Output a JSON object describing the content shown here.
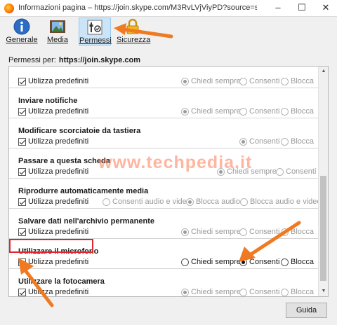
{
  "window": {
    "title": "Informazioni pagina – https://join.skype.com/M3RvLVjViyPD?source=scom&co...",
    "minimize": "–",
    "maximize": "☐",
    "close": "✕"
  },
  "toolbar": {
    "tabs": [
      {
        "label": "Generale",
        "icon": "info-icon",
        "active": false
      },
      {
        "label": "Media",
        "icon": "media-icon",
        "active": false
      },
      {
        "label": "Permessi",
        "icon": "permissions-icon",
        "active": true
      },
      {
        "label": "Sicurezza",
        "icon": "lock-icon",
        "active": false
      }
    ]
  },
  "permissions_for": {
    "label": "Permessi per:",
    "site": "https://join.skype.com"
  },
  "use_default_label": "Utilizza predefiniti",
  "permissions": [
    {
      "title": "",
      "use_default": true,
      "options": [
        "Chiedi sempre",
        "Consenti",
        "Blocca"
      ],
      "selected": "Chiedi sempre",
      "enabled": false
    },
    {
      "title": "Inviare notifiche",
      "use_default": true,
      "options": [
        "Chiedi sempre",
        "Consenti",
        "Blocca"
      ],
      "selected": "Chiedi sempre",
      "enabled": false
    },
    {
      "title": "Modificare scorciatoie da tastiera",
      "use_default": true,
      "options": [
        "Consenti",
        "Blocca"
      ],
      "selected": "Consenti",
      "enabled": false
    },
    {
      "title": "Passare a questa scheda",
      "use_default": true,
      "options": [
        "Chiedi sempre",
        "Consenti"
      ],
      "selected": "Chiedi sempre",
      "enabled": false
    },
    {
      "title": "Riprodurre automaticamente media",
      "use_default": true,
      "options": [
        "Consenti audio e video",
        "Blocca audio",
        "Blocca audio e video"
      ],
      "selected": "Blocca audio",
      "enabled": false
    },
    {
      "title": "Salvare dati nell'archivio permanente",
      "use_default": true,
      "options": [
        "Chiedi sempre",
        "Consenti",
        "Blocca"
      ],
      "selected": "Chiedi sempre",
      "enabled": false
    },
    {
      "title": "Utilizzare il microfono",
      "use_default": false,
      "options": [
        "Chiedi sempre",
        "Consenti",
        "Blocca"
      ],
      "selected": "Consenti",
      "enabled": true
    },
    {
      "title": "Utilizzare la fotocamera",
      "use_default": true,
      "options": [
        "Chiedi sempre",
        "Consenti",
        "Blocca"
      ],
      "selected": "Chiedi sempre",
      "enabled": false
    }
  ],
  "watermark": "www.techpedia.it",
  "help_button": "Guida",
  "colors": {
    "accent_arrow": "#f07a22",
    "highlight_box": "#e0262f",
    "active_tab": "#cce4f7"
  }
}
